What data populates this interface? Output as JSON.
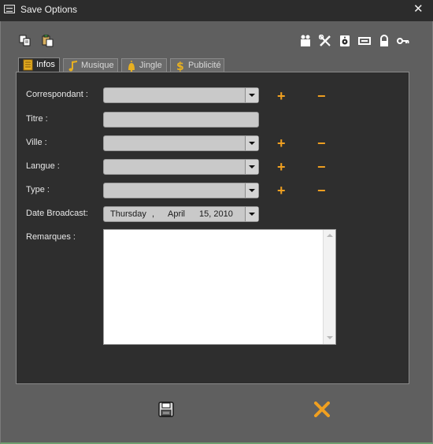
{
  "window": {
    "title": "Save Options"
  },
  "toolbar": {
    "left_icons": [
      "copy-icon",
      "paste-icon"
    ],
    "right_icons": [
      "people-icon",
      "tools-icon",
      "speaker-icon",
      "network-card-icon",
      "lock-icon",
      "key-icon"
    ]
  },
  "tabs": [
    {
      "label": "Infos",
      "icon": "document-icon",
      "active": true
    },
    {
      "label": "Musique",
      "icon": "music-note-icon",
      "active": false
    },
    {
      "label": "Jingle",
      "icon": "bell-icon",
      "active": false
    },
    {
      "label": "Publicité",
      "icon": "dollar-icon",
      "active": false
    }
  ],
  "form": {
    "correspondant_label": "Correspondant :",
    "titre_label": "Titre :",
    "ville_label": "Ville :",
    "langue_label": "Langue :",
    "type_label": "Type :",
    "date_label": "Date Broadcast:",
    "date": {
      "weekday": "Thursday",
      "sep": ",",
      "month": "April",
      "day_year": "15, 2010"
    },
    "remarques_label": "Remarques :",
    "add_symbol": "+",
    "remove_symbol": "−"
  },
  "colors": {
    "accent": "#f0a020",
    "panel": "#2e2e2e",
    "window": "#5f5f5f",
    "titlebar": "#2c2c2c"
  }
}
